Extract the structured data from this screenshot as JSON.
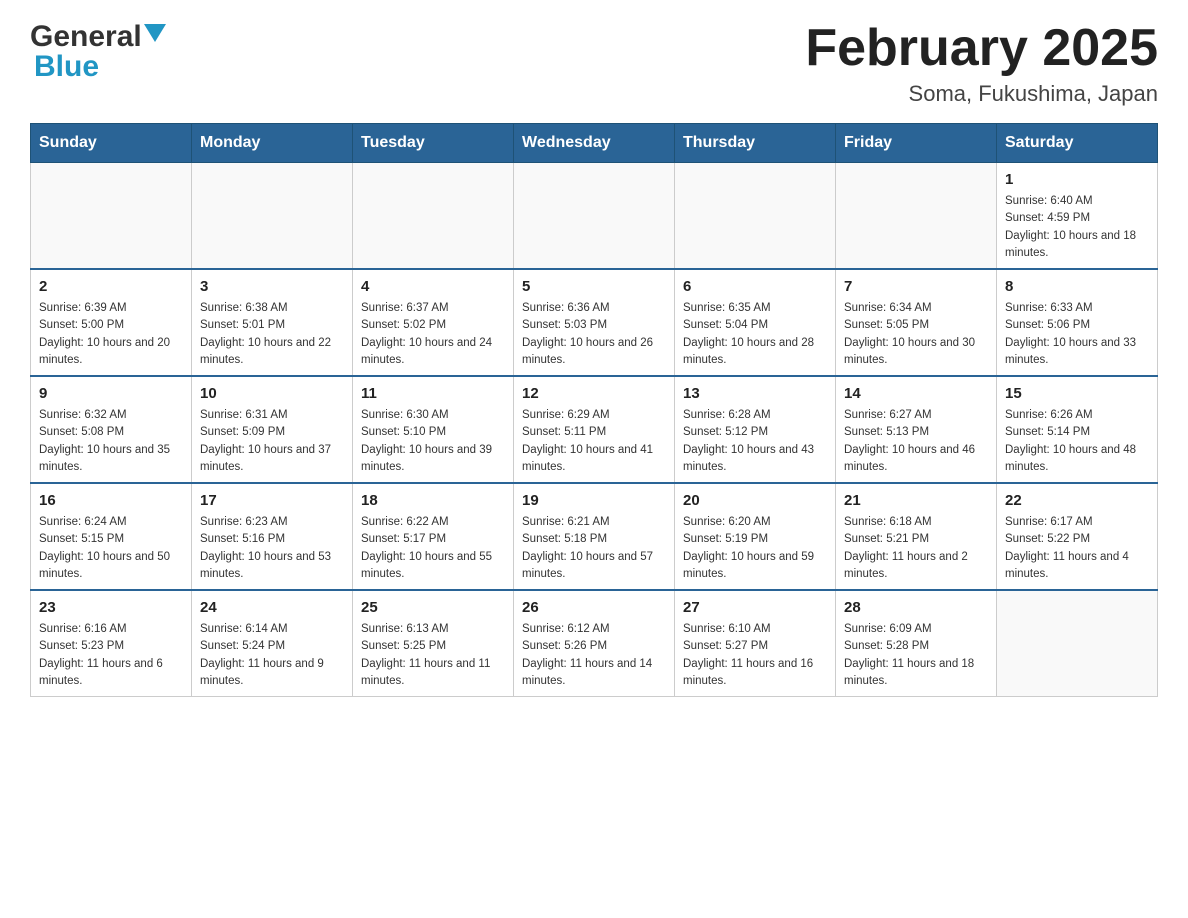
{
  "header": {
    "logo_general": "General",
    "logo_blue": "Blue",
    "title": "February 2025",
    "subtitle": "Soma, Fukushima, Japan"
  },
  "days_of_week": [
    "Sunday",
    "Monday",
    "Tuesday",
    "Wednesday",
    "Thursday",
    "Friday",
    "Saturday"
  ],
  "weeks": [
    [
      {
        "day": "",
        "info": ""
      },
      {
        "day": "",
        "info": ""
      },
      {
        "day": "",
        "info": ""
      },
      {
        "day": "",
        "info": ""
      },
      {
        "day": "",
        "info": ""
      },
      {
        "day": "",
        "info": ""
      },
      {
        "day": "1",
        "info": "Sunrise: 6:40 AM\nSunset: 4:59 PM\nDaylight: 10 hours and 18 minutes."
      }
    ],
    [
      {
        "day": "2",
        "info": "Sunrise: 6:39 AM\nSunset: 5:00 PM\nDaylight: 10 hours and 20 minutes."
      },
      {
        "day": "3",
        "info": "Sunrise: 6:38 AM\nSunset: 5:01 PM\nDaylight: 10 hours and 22 minutes."
      },
      {
        "day": "4",
        "info": "Sunrise: 6:37 AM\nSunset: 5:02 PM\nDaylight: 10 hours and 24 minutes."
      },
      {
        "day": "5",
        "info": "Sunrise: 6:36 AM\nSunset: 5:03 PM\nDaylight: 10 hours and 26 minutes."
      },
      {
        "day": "6",
        "info": "Sunrise: 6:35 AM\nSunset: 5:04 PM\nDaylight: 10 hours and 28 minutes."
      },
      {
        "day": "7",
        "info": "Sunrise: 6:34 AM\nSunset: 5:05 PM\nDaylight: 10 hours and 30 minutes."
      },
      {
        "day": "8",
        "info": "Sunrise: 6:33 AM\nSunset: 5:06 PM\nDaylight: 10 hours and 33 minutes."
      }
    ],
    [
      {
        "day": "9",
        "info": "Sunrise: 6:32 AM\nSunset: 5:08 PM\nDaylight: 10 hours and 35 minutes."
      },
      {
        "day": "10",
        "info": "Sunrise: 6:31 AM\nSunset: 5:09 PM\nDaylight: 10 hours and 37 minutes."
      },
      {
        "day": "11",
        "info": "Sunrise: 6:30 AM\nSunset: 5:10 PM\nDaylight: 10 hours and 39 minutes."
      },
      {
        "day": "12",
        "info": "Sunrise: 6:29 AM\nSunset: 5:11 PM\nDaylight: 10 hours and 41 minutes."
      },
      {
        "day": "13",
        "info": "Sunrise: 6:28 AM\nSunset: 5:12 PM\nDaylight: 10 hours and 43 minutes."
      },
      {
        "day": "14",
        "info": "Sunrise: 6:27 AM\nSunset: 5:13 PM\nDaylight: 10 hours and 46 minutes."
      },
      {
        "day": "15",
        "info": "Sunrise: 6:26 AM\nSunset: 5:14 PM\nDaylight: 10 hours and 48 minutes."
      }
    ],
    [
      {
        "day": "16",
        "info": "Sunrise: 6:24 AM\nSunset: 5:15 PM\nDaylight: 10 hours and 50 minutes."
      },
      {
        "day": "17",
        "info": "Sunrise: 6:23 AM\nSunset: 5:16 PM\nDaylight: 10 hours and 53 minutes."
      },
      {
        "day": "18",
        "info": "Sunrise: 6:22 AM\nSunset: 5:17 PM\nDaylight: 10 hours and 55 minutes."
      },
      {
        "day": "19",
        "info": "Sunrise: 6:21 AM\nSunset: 5:18 PM\nDaylight: 10 hours and 57 minutes."
      },
      {
        "day": "20",
        "info": "Sunrise: 6:20 AM\nSunset: 5:19 PM\nDaylight: 10 hours and 59 minutes."
      },
      {
        "day": "21",
        "info": "Sunrise: 6:18 AM\nSunset: 5:21 PM\nDaylight: 11 hours and 2 minutes."
      },
      {
        "day": "22",
        "info": "Sunrise: 6:17 AM\nSunset: 5:22 PM\nDaylight: 11 hours and 4 minutes."
      }
    ],
    [
      {
        "day": "23",
        "info": "Sunrise: 6:16 AM\nSunset: 5:23 PM\nDaylight: 11 hours and 6 minutes."
      },
      {
        "day": "24",
        "info": "Sunrise: 6:14 AM\nSunset: 5:24 PM\nDaylight: 11 hours and 9 minutes."
      },
      {
        "day": "25",
        "info": "Sunrise: 6:13 AM\nSunset: 5:25 PM\nDaylight: 11 hours and 11 minutes."
      },
      {
        "day": "26",
        "info": "Sunrise: 6:12 AM\nSunset: 5:26 PM\nDaylight: 11 hours and 14 minutes."
      },
      {
        "day": "27",
        "info": "Sunrise: 6:10 AM\nSunset: 5:27 PM\nDaylight: 11 hours and 16 minutes."
      },
      {
        "day": "28",
        "info": "Sunrise: 6:09 AM\nSunset: 5:28 PM\nDaylight: 11 hours and 18 minutes."
      },
      {
        "day": "",
        "info": ""
      }
    ]
  ]
}
